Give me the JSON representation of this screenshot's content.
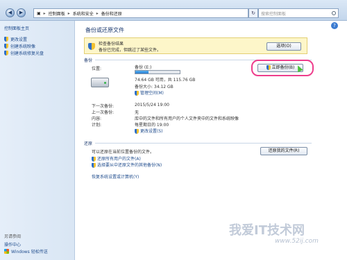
{
  "addressbar": {
    "crumbs": [
      "控制面板",
      "系统和安全",
      "备份和还原"
    ],
    "search_placeholder": "搜索控制面板"
  },
  "sidebar": {
    "title": "控制面板主页",
    "items": [
      {
        "label": "更改设置",
        "icon": "shield-icon"
      },
      {
        "label": "创建系统映像",
        "icon": "shield-icon"
      },
      {
        "label": "创建系统修复光盘",
        "icon": "shield-icon"
      }
    ],
    "see_also_title": "另请参阅",
    "see_also": [
      {
        "label": "操作中心"
      },
      {
        "label": "Windows 轻松传送",
        "icon": "windows-flag-icon"
      }
    ]
  },
  "main": {
    "title": "备份或还原文件",
    "warning": {
      "title": "检查备份结果",
      "text": "备份已完成，但跳过了某些文件。",
      "button": "选项(O)"
    },
    "backup": {
      "section_label": "备份",
      "location_label": "位置:",
      "location_value": "备份 (E:)",
      "progress_fraction": 0.3,
      "free_space": "74.64 GB 可用，共 115.76 GB",
      "backup_size": "备份大小: 34.12 GB",
      "manage_space_link": "管理空间(M)",
      "backup_now_button": "立即备份(B)",
      "next_backup_label": "下一次备份:",
      "next_backup_value": "2015/5/24 19:00",
      "last_backup_label": "上一次备份:",
      "last_backup_value": "无",
      "contents_label": "内容:",
      "contents_value": "库中的文件和所有用户的个人文件夹中的文件和系统映像",
      "schedule_label": "计划:",
      "schedule_value": "每星期日的 19:00",
      "change_settings_link": "更改设置(S)"
    },
    "restore": {
      "section_label": "还原",
      "text": "可以还原在当前位置备份的文件。",
      "button": "还原我的文件(R)",
      "link_all_users": "还原所有用户的文件(A)",
      "link_other_backup": "选择要从中还原文件的其他备份(N)",
      "link_recover": "恢复系统设置或计算机(Y)"
    }
  },
  "watermark": {
    "text": "我爱IT技术网",
    "url": "www.52ij.com"
  },
  "colors": {
    "highlight": "#ee3d8c",
    "link": "#1e4b8c",
    "warning_bg": "#fdf6c9"
  }
}
